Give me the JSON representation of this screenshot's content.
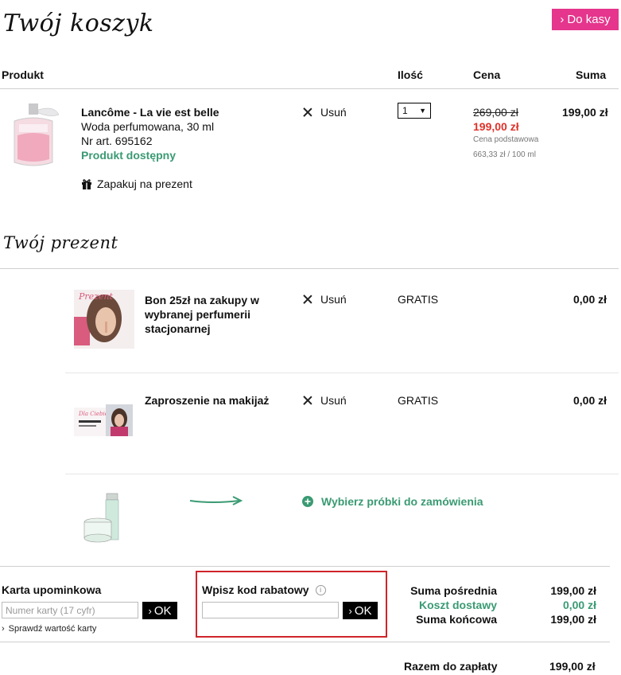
{
  "header": {
    "title": "Twój koszyk",
    "checkout_label": "Do kasy"
  },
  "columns": {
    "product": "Produkt",
    "quantity": "Ilość",
    "price": "Cena",
    "sum": "Suma"
  },
  "cart_item": {
    "name": "Lancôme - La vie est belle",
    "type": "Woda perfumowana, 30 ml",
    "article": "Nr art. 695162",
    "availability": "Produkt dostępny",
    "remove_label": "Usuń",
    "quantity": "1",
    "old_price": "269,00 zł",
    "new_price": "199,00 zł",
    "base_price_label": "Cena podstawowa",
    "unit_price": "663,33 zł / 100 ml",
    "total": "199,00 zł",
    "gift_wrap_label": "Zapakuj na prezent"
  },
  "gifts_section": {
    "title": "Twój prezent",
    "items": [
      {
        "name": "Bon 25zł na zakupy w wybranej perfumerii stacjonarnej",
        "remove_label": "Usuń",
        "price": "GRATIS",
        "total": "0,00 zł"
      },
      {
        "name": "Zaproszenie na makijaż",
        "remove_label": "Usuń",
        "price": "GRATIS",
        "total": "0,00 zł"
      }
    ],
    "samples_label": "Wybierz próbki do zamówienia"
  },
  "gift_card": {
    "title": "Karta upominkowa",
    "placeholder": "Numer karty (17 cyfr)",
    "ok_label": "OK",
    "check_link": "Sprawdź wartość karty"
  },
  "discount": {
    "title": "Wpisz kod rabatowy",
    "placeholder": "",
    "ok_label": "OK",
    "highlight_color": "#d0242b"
  },
  "summary": {
    "subtotal_label": "Suma pośrednia",
    "subtotal": "199,00 zł",
    "shipping_label": "Koszt dostawy",
    "shipping": "0,00 zł",
    "final_label": "Suma końcowa",
    "final": "199,00 zł",
    "to_pay_label": "Razem do zapłaty",
    "to_pay": "199,00 zł"
  },
  "colors": {
    "accent": "#e5358c",
    "green": "#3a9a73",
    "red": "#e0322a"
  }
}
